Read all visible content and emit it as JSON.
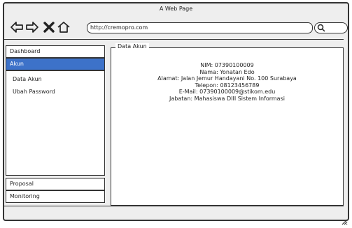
{
  "window": {
    "title": "A Web Page"
  },
  "browser": {
    "url": "http://cremopro.com"
  },
  "sidebar": {
    "items": [
      {
        "label": "Dashboard"
      },
      {
        "label": "Akun"
      },
      {
        "label": "Proposal"
      },
      {
        "label": "Monitoring"
      }
    ],
    "sub_items": [
      {
        "label": "Data Akun"
      },
      {
        "label": "Ubah Password"
      }
    ]
  },
  "main": {
    "legend": "Data Akun",
    "lines": [
      "NIM: 07390100009",
      "Nama: Yonatan Edo",
      "Alamat: Jalan Jemur Handayani No. 100 Surabaya",
      "Telepon: 08123456789",
      "E-Mail: 07390100009@stikom.edu",
      "Jabatan: Mahasiswa DIII Sistem Informasi"
    ]
  },
  "icons": {
    "back": "arrow-left-icon",
    "forward": "arrow-right-icon",
    "stop": "close-icon",
    "home": "home-icon",
    "search": "search-icon",
    "resize": "resize-grip-icon"
  },
  "colors": {
    "active_item": "#3d72c9",
    "chrome": "#eeeeee",
    "outline": "#333333"
  }
}
